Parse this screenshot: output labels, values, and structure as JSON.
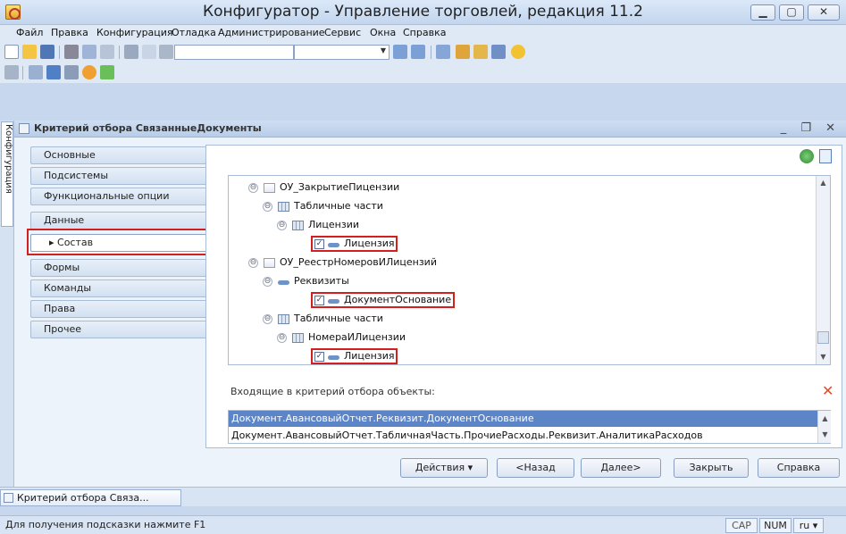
{
  "window": {
    "title": "Конфигуратор - Управление торговлей, редакция 11.2"
  },
  "menu": [
    "Файл",
    "Правка",
    "Конфигурация",
    "Отладка",
    "Администрирование",
    "Сервис",
    "Окна",
    "Справка"
  ],
  "left_strip": {
    "tab_label": "Конфигурация"
  },
  "inner_window": {
    "title": "Критерий отбора СвязанныеДокументы"
  },
  "nav": [
    {
      "label": "Основные",
      "active": false
    },
    {
      "label": "Подсистемы",
      "active": false
    },
    {
      "label": "Функциональные опции",
      "active": false
    },
    {
      "label": "Данные",
      "active": false
    },
    {
      "label": "▸ Состав",
      "active": true
    },
    {
      "label": "Формы",
      "active": false
    },
    {
      "label": "Команды",
      "active": false
    },
    {
      "label": "Права",
      "active": false
    },
    {
      "label": "Прочее",
      "active": false
    }
  ],
  "tree": [
    {
      "label": "ОУ_ЗакрытиеПицензии",
      "level": 0,
      "icon": "doc",
      "expander": "⊖",
      "checkbox": false,
      "highlight": false
    },
    {
      "label": "Табличные части",
      "level": 1,
      "icon": "table",
      "expander": "⊖",
      "checkbox": false,
      "highlight": false
    },
    {
      "label": "Лицензии",
      "level": 2,
      "icon": "table",
      "expander": "⊖",
      "checkbox": false,
      "highlight": false
    },
    {
      "label": "Лицензия",
      "level": 3,
      "icon": "attr",
      "expander": "",
      "checkbox": true,
      "highlight": true
    },
    {
      "label": "ОУ_РеестрНомеровИЛицензий",
      "level": 0,
      "icon": "doc",
      "expander": "⊖",
      "checkbox": false,
      "highlight": false
    },
    {
      "label": "Реквизиты",
      "level": 1,
      "icon": "attr",
      "expander": "⊖",
      "checkbox": false,
      "highlight": false
    },
    {
      "label": "ДокументОснование",
      "level": 3,
      "icon": "attr",
      "expander": "",
      "checkbox": true,
      "highlight": true
    },
    {
      "label": "Табличные части",
      "level": 1,
      "icon": "table",
      "expander": "⊖",
      "checkbox": false,
      "highlight": false
    },
    {
      "label": "НомераИЛицензии",
      "level": 2,
      "icon": "table",
      "expander": "⊖",
      "checkbox": false,
      "highlight": false
    },
    {
      "label": "Лицензия",
      "level": 3,
      "icon": "attr",
      "expander": "",
      "checkbox": true,
      "highlight": true
    }
  ],
  "incoming": {
    "label": "Входящие в критерий отбора объекты:",
    "rows": [
      "Документ.АвансовыйОтчет.Реквизит.ДокументОснование",
      "Документ.АвансовыйОтчет.ТабличнаяЧасть.ПрочиеРасходы.Реквизит.АналитикаРасходов"
    ]
  },
  "buttons": {
    "actions": "Действия ▾",
    "back": "<Назад",
    "next": "Далее>",
    "close": "Закрыть",
    "help": "Справка"
  },
  "taskbar": {
    "item": "Критерий отбора Связа..."
  },
  "status": {
    "hint": "Для получения подсказки нажмите F1",
    "cap": "CAP",
    "num": "NUM",
    "lang": "ru ▾"
  },
  "icons": {
    "edit": "edit-icon",
    "copy": "copy-icon",
    "delete": "delete-icon"
  },
  "colors": {
    "accent": "#5c85c7",
    "highlight_box": "#d21f1f",
    "delete": "#e24b2a"
  }
}
